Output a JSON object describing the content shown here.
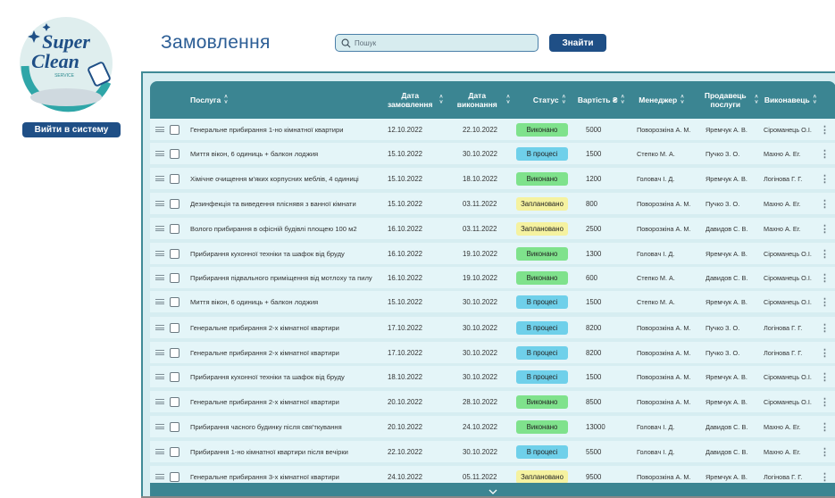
{
  "logo": {
    "line1": "Super",
    "line2": "Clean",
    "line3": "SERVICE"
  },
  "sidebar": {
    "login_label": "Вийти в систему"
  },
  "header": {
    "title": "Замовлення",
    "search_placeholder": "Пошук",
    "find_label": "Знайти"
  },
  "colors": {
    "accent": "#1f4f86",
    "table_header": "#3b8592",
    "done": "#7fe28c",
    "progress": "#6fd0ea",
    "planned": "#f5f2a0"
  },
  "table": {
    "columns": [
      {
        "key": "service",
        "label": "Послуга"
      },
      {
        "key": "order_date",
        "label": "Дата замовлення"
      },
      {
        "key": "done_date",
        "label": "Дата виконання"
      },
      {
        "key": "status",
        "label": "Статус"
      },
      {
        "key": "price",
        "label": "Вартість ₴"
      },
      {
        "key": "manager",
        "label": "Менеджер"
      },
      {
        "key": "seller",
        "label": "Продавець послуги"
      },
      {
        "key": "executor",
        "label": "Виконавець"
      }
    ],
    "rows": [
      {
        "service": "Генеральне прибирання 1-но кімнатної квартири",
        "order_date": "12.10.2022",
        "done_date": "22.10.2022",
        "status": "Виконано",
        "price": "5000",
        "manager": "Поворозкіна А. М.",
        "seller": "Яремчук А. В.",
        "executor": "Сіроманець О.І."
      },
      {
        "service": "Миття вікон, 6 одиниць + балкон лоджия",
        "order_date": "15.10.2022",
        "done_date": "30.10.2022",
        "status": "В процесі",
        "price": "1500",
        "manager": "Степко М. А.",
        "seller": "Пучко З. О.",
        "executor": "Махно А. Ег."
      },
      {
        "service": "Хімічне очищення м'яких корпусних меблів, 4 одиниці",
        "order_date": "15.10.2022",
        "done_date": "18.10.2022",
        "status": "Виконано",
        "price": "1200",
        "manager": "Головач І. Д.",
        "seller": "Яремчук А. В.",
        "executor": "Логінова Г. Г."
      },
      {
        "service": "Дезинфекція та виведення пліснявя з ванної кімнати",
        "order_date": "15.10.2022",
        "done_date": "03.11.2022",
        "status": "Заплановано",
        "price": "800",
        "manager": "Поворозкіна А. М.",
        "seller": "Пучко З. О.",
        "executor": "Махно А. Ег."
      },
      {
        "service": "Волого прибирання в офісній будівлі площею 100 м2",
        "order_date": "16.10.2022",
        "done_date": "03.11.2022",
        "status": "Заплановано",
        "price": "2500",
        "manager": "Поворозкіна А. М.",
        "seller": "Давидов С. В.",
        "executor": "Махно А. Ег."
      },
      {
        "service": "Прибирання кухонної техніки та шафок від бруду",
        "order_date": "16.10.2022",
        "done_date": "19.10.2022",
        "status": "Виконано",
        "price": "1300",
        "manager": "Головач І. Д.",
        "seller": "Яремчук А. В.",
        "executor": "Сіроманець О.І."
      },
      {
        "service": "Прибирання підвального приміщення від мотлоху та пилу",
        "order_date": "16.10.2022",
        "done_date": "19.10.2022",
        "status": "Виконано",
        "price": "600",
        "manager": "Степко М. А.",
        "seller": "Давидов С. В.",
        "executor": "Сіроманець О.І."
      },
      {
        "service": "Миття вікон, 6 одиниць + балкон лоджия",
        "order_date": "15.10.2022",
        "done_date": "30.10.2022",
        "status": "В процесі",
        "price": "1500",
        "manager": "Степко М. А.",
        "seller": "Яремчук А. В.",
        "executor": "Сіроманець О.І."
      },
      {
        "service": "Генеральне прибирання 2-х кімнатної квартири",
        "order_date": "17.10.2022",
        "done_date": "30.10.2022",
        "status": "В процесі",
        "price": "8200",
        "manager": "Поворозкіна А. М.",
        "seller": "Пучко З. О.",
        "executor": "Логінова Г. Г."
      },
      {
        "service": "Генеральне прибирання 2-х кімнатної квартири",
        "order_date": "17.10.2022",
        "done_date": "30.10.2022",
        "status": "В процесі",
        "price": "8200",
        "manager": "Поворозкіна А. М.",
        "seller": "Пучко З. О.",
        "executor": "Логінова Г. Г."
      },
      {
        "service": "Прибирання кухонної техніки та шафок від бруду",
        "order_date": "18.10.2022",
        "done_date": "30.10.2022",
        "status": "В процесі",
        "price": "1500",
        "manager": "Поворозкіна А. М.",
        "seller": "Яремчук А. В.",
        "executor": "Сіроманець О.І."
      },
      {
        "service": "Генеральне прибирання 2-х кімнатної квартири",
        "order_date": "20.10.2022",
        "done_date": "28.10.2022",
        "status": "Виконано",
        "price": "8500",
        "manager": "Поворозкіна А. М.",
        "seller": "Яремчук А. В.",
        "executor": "Сіроманець О.І."
      },
      {
        "service": "Прибирання часного будинку після свя'ткування",
        "order_date": "20.10.2022",
        "done_date": "24.10.2022",
        "status": "Виконано",
        "price": "13000",
        "manager": "Головач І. Д.",
        "seller": "Давидов С. В.",
        "executor": "Махно А. Ег."
      },
      {
        "service": "Прибирання 1-но кімнатної квартири після вечірки",
        "order_date": "22.10.2022",
        "done_date": "30.10.2022",
        "status": "В процесі",
        "price": "5500",
        "manager": "Головач І. Д.",
        "seller": "Давидов С. В.",
        "executor": "Махно А. Ег."
      },
      {
        "service": "Генеральне прибирання 3-х кімнатної квартири",
        "order_date": "24.10.2022",
        "done_date": "05.11.2022",
        "status": "Заплановано",
        "price": "9500",
        "manager": "Поворозкіна А. М.",
        "seller": "Яремчук А. В.",
        "executor": "Логінова Г. Г."
      }
    ]
  }
}
